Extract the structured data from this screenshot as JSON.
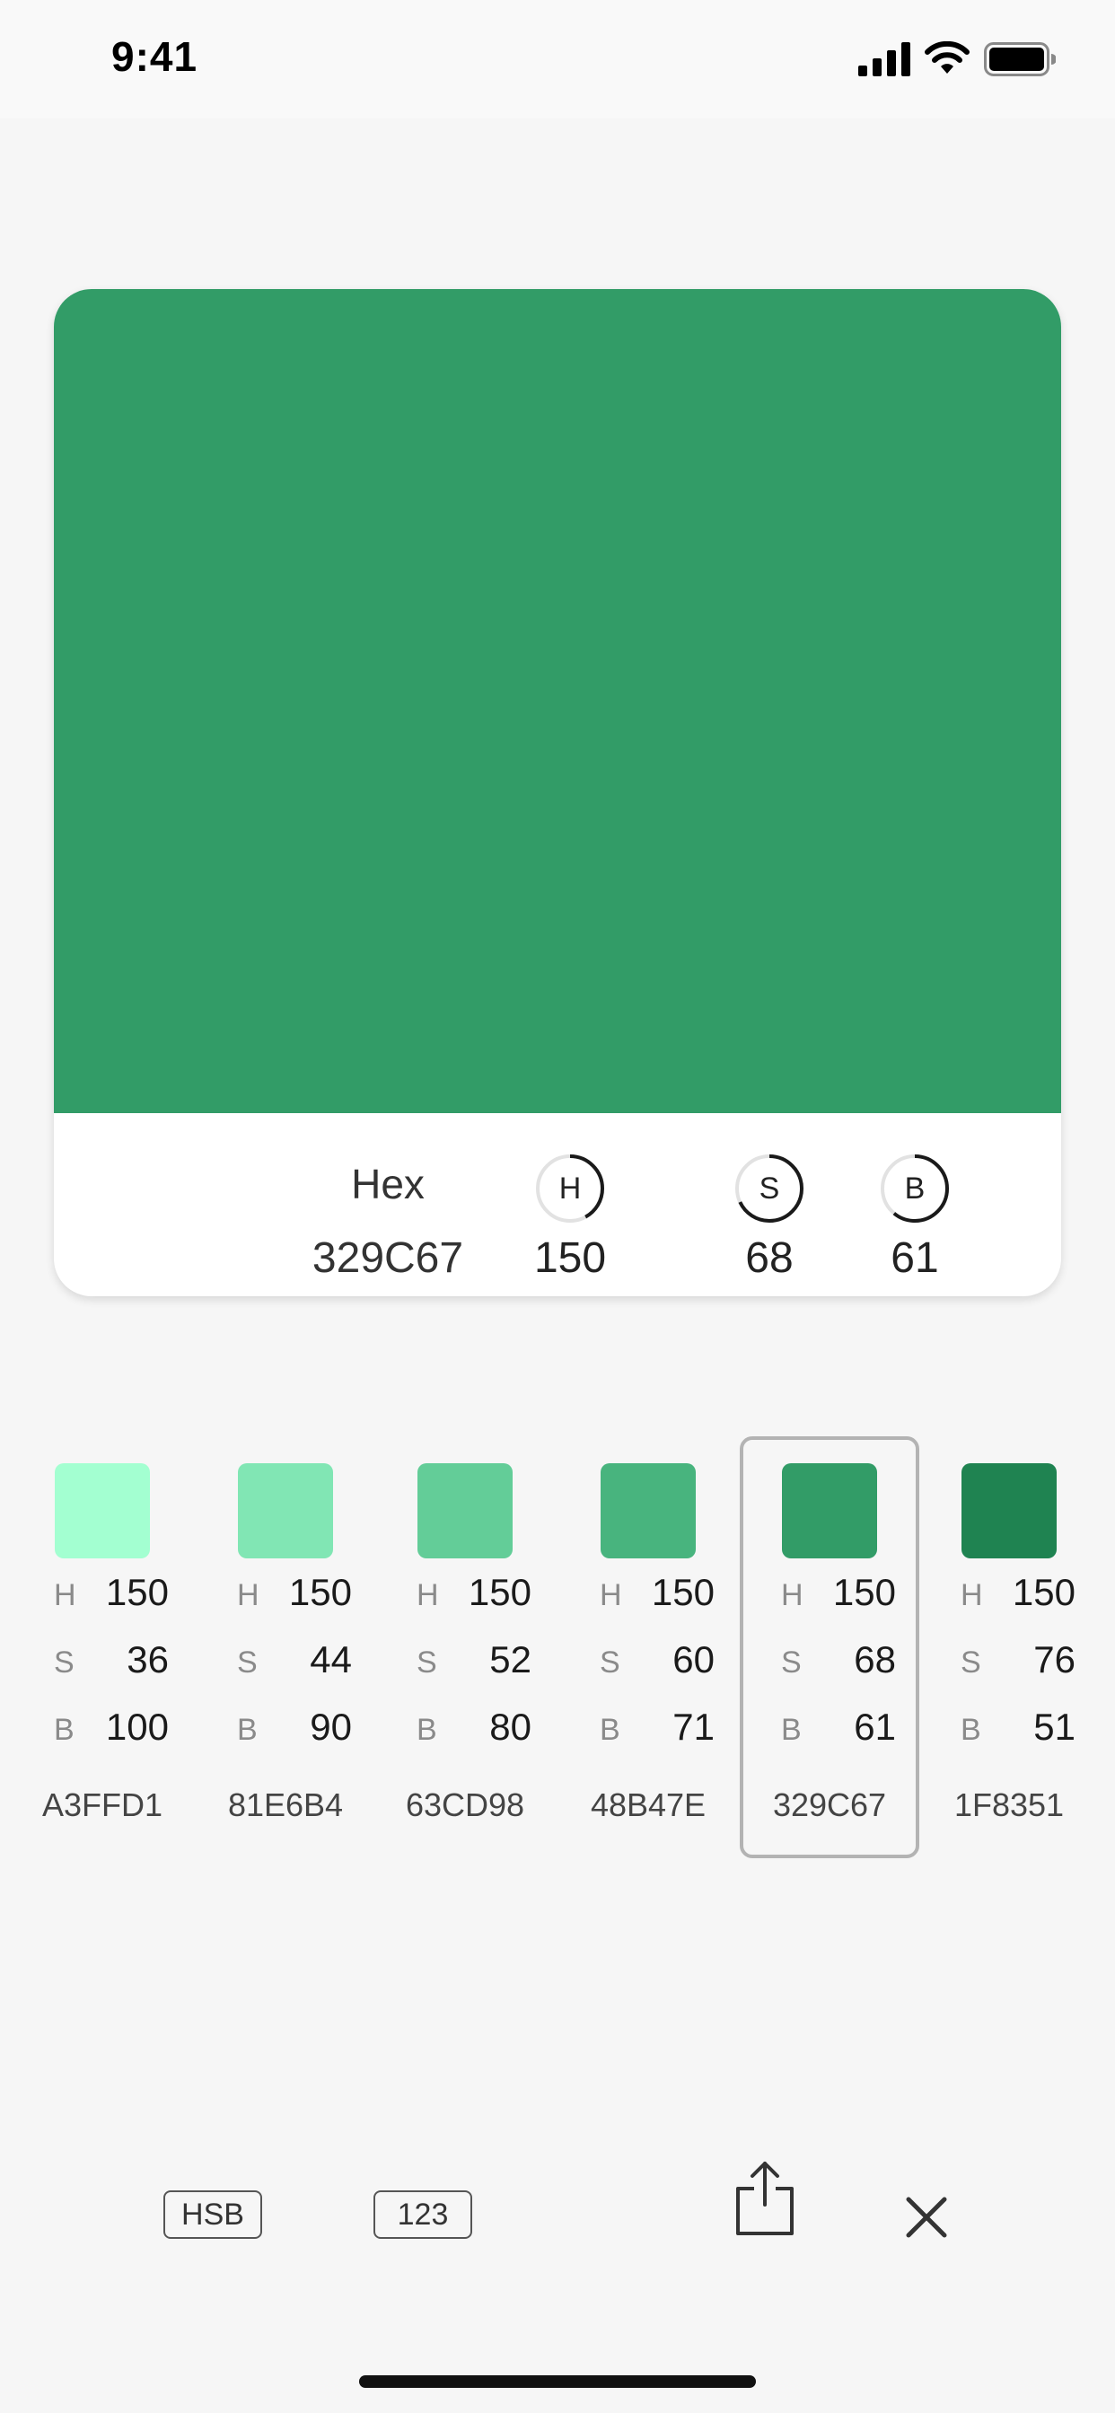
{
  "status_bar": {
    "time": "9:41"
  },
  "card": {
    "color": "#329C67",
    "hex_label": "Hex",
    "hex_value": "329C67",
    "h_letter": "H",
    "s_letter": "S",
    "b_letter": "B",
    "h_value": "150",
    "s_value": "68",
    "b_value": "61",
    "h_fraction": 0.42,
    "s_fraction": 0.68,
    "b_fraction": 0.61
  },
  "palette": [
    {
      "color": "#A3FFD1",
      "h": "150",
      "s": "36",
      "b": "100",
      "hex": "A3FFD1",
      "selected": false
    },
    {
      "color": "#81E6B4",
      "h": "150",
      "s": "44",
      "b": "90",
      "hex": "81E6B4",
      "selected": false
    },
    {
      "color": "#63CD98",
      "h": "150",
      "s": "52",
      "b": "80",
      "hex": "63CD98",
      "selected": false
    },
    {
      "color": "#48B47E",
      "h": "150",
      "s": "60",
      "b": "71",
      "hex": "48B47E",
      "selected": false
    },
    {
      "color": "#329C67",
      "h": "150",
      "s": "68",
      "b": "61",
      "hex": "329C67",
      "selected": true
    },
    {
      "color": "#1F8351",
      "h": "150",
      "s": "76",
      "b": "51",
      "hex": "1F8351",
      "selected": false
    }
  ],
  "palette_labels": {
    "h": "H",
    "s": "S",
    "b": "B"
  },
  "toolbar": {
    "hsb_label": "HSB",
    "number_label": "123",
    "share_icon": "share-icon",
    "close_icon": "close-icon"
  }
}
